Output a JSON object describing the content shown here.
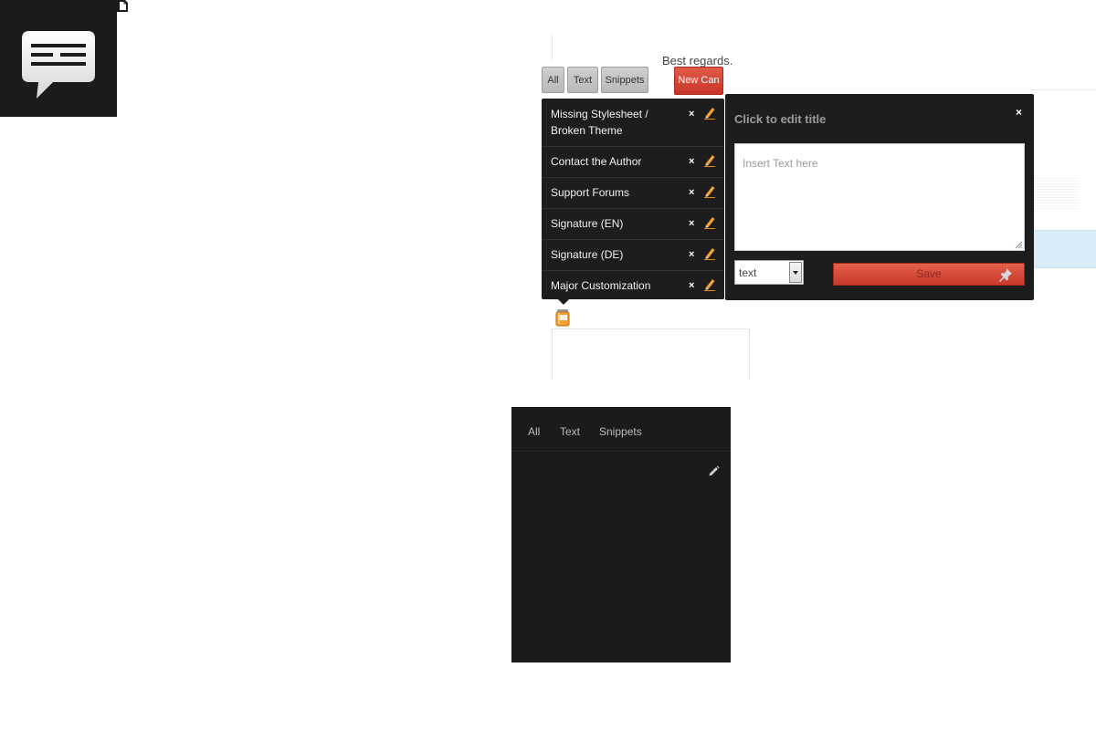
{
  "app_icon": {
    "name": "speech-bubble-icon"
  },
  "background": {
    "closing_text": "Best regards."
  },
  "filters": {
    "all_label": "All",
    "text_label": "Text",
    "snippets_label": "Snippets",
    "new_can_label": "New Can"
  },
  "cans": [
    {
      "label_line1": "Missing Stylesheet /",
      "label_line2": "Broken Theme"
    },
    {
      "label_line1": "Contact the Author",
      "label_line2": ""
    },
    {
      "label_line1": "Support Forums",
      "label_line2": ""
    },
    {
      "label_line1": "Signature (EN)",
      "label_line2": ""
    },
    {
      "label_line1": "Signature (DE)",
      "label_line2": ""
    },
    {
      "label_line1": "Major Customization",
      "label_line2": ""
    }
  ],
  "can_actions": {
    "delete_glyph": "×"
  },
  "editor": {
    "title": "Click to edit title",
    "close_glyph": "×",
    "text_placeholder": "Insert Text here",
    "type_value": "text",
    "save_label": "Save"
  },
  "lower_panel": {
    "tabs": [
      "All",
      "Text",
      "Snippets"
    ]
  },
  "colors": {
    "dark_panel": "#1d1d1d",
    "accent_red": "#d0402f",
    "tab_gray": "#c4c4c4"
  }
}
